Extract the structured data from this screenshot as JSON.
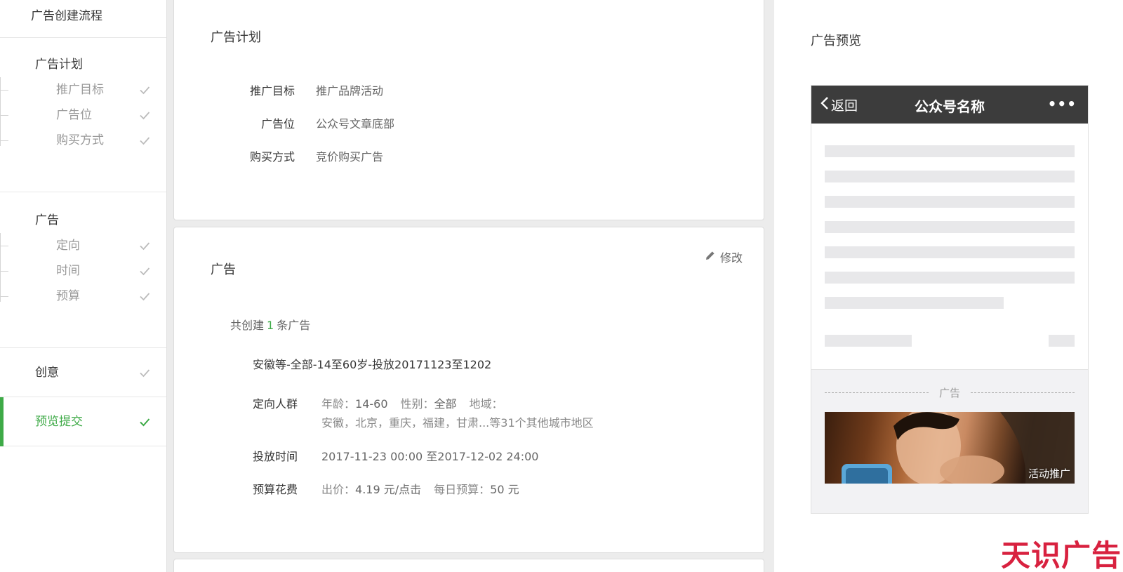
{
  "sidebar": {
    "title": "广告创建流程",
    "plan_group": {
      "label": "广告计划",
      "items": [
        {
          "label": "推广目标",
          "done": true
        },
        {
          "label": "广告位",
          "done": true
        },
        {
          "label": "购买方式",
          "done": true
        }
      ]
    },
    "ad_group": {
      "label": "广告",
      "items": [
        {
          "label": "定向",
          "done": true
        },
        {
          "label": "时间",
          "done": true
        },
        {
          "label": "预算",
          "done": true
        }
      ]
    },
    "creative": {
      "label": "创意",
      "done": true
    },
    "preview_submit": {
      "label": "预览提交",
      "done": true,
      "active": true
    }
  },
  "plan_card": {
    "title": "广告计划",
    "rows": [
      {
        "key": "推广目标",
        "value": "推广品牌活动"
      },
      {
        "key": "广告位",
        "value": "公众号文章底部"
      },
      {
        "key": "购买方式",
        "value": "竞价购买广告"
      }
    ]
  },
  "ad_card": {
    "title": "广告",
    "edit_label": "修改",
    "count_prefix": "共创建",
    "count": "1",
    "count_suffix": "条广告",
    "ad_name": "安徽等-全部-14至60岁-投放20171123至1202",
    "targeting": {
      "key": "定向人群",
      "age_label": "年龄：",
      "age_value": "14-60",
      "gender_label": "性别：",
      "gender_value": "全部",
      "region_label": "地域：",
      "region_value": "安徽，北京，重庆，福建，甘肃...等31个其他城市地区"
    },
    "schedule": {
      "key": "投放时间",
      "value": "2017-11-23 00:00 至2017-12-02 24:00"
    },
    "budget": {
      "key": "预算花费",
      "bid_label": "出价：",
      "bid_value": "4.19 元/点击",
      "daily_label": "每日预算：",
      "daily_value": "50 元"
    }
  },
  "preview": {
    "title": "广告预览",
    "back_label": "返回",
    "account_name": "公众号名称",
    "more_label": "•••",
    "ad_divider_label": "广告",
    "ad_tag": "活动推广"
  },
  "watermark": "天识广告",
  "colors": {
    "accent": "#3eaa47",
    "phone_bar": "#3c3c3c",
    "watermark": "#d8213f"
  },
  "icons": {
    "done": "check-icon",
    "edit": "pencil-icon",
    "back": "chevron-left-icon",
    "more": "more-icon"
  }
}
